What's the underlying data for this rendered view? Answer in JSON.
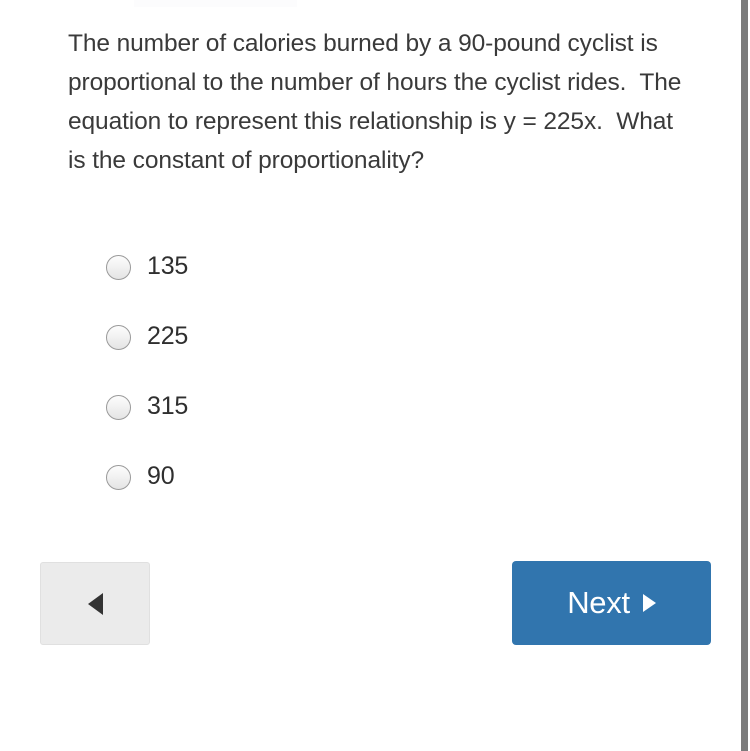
{
  "quiz": {
    "question": "The number of calories burned by a 90-pound cyclist is proportional to the number of hours the cyclist rides.  The equation to represent this relationship is y = 225x.  What is the constant of proportionality?",
    "options": [
      {
        "label": "135",
        "selected": false
      },
      {
        "label": "225",
        "selected": false
      },
      {
        "label": "315",
        "selected": false
      },
      {
        "label": "90",
        "selected": false
      }
    ]
  },
  "navigation": {
    "back_icon": "triangle-left-icon",
    "next_label": "Next",
    "next_icon": "triangle-right-icon"
  },
  "colors": {
    "next_button_blue": "#3175ae",
    "back_button_gray": "#ebebeb",
    "text_dark": "#3a3a3a",
    "scrollbar_gray": "#7b7b7b"
  }
}
